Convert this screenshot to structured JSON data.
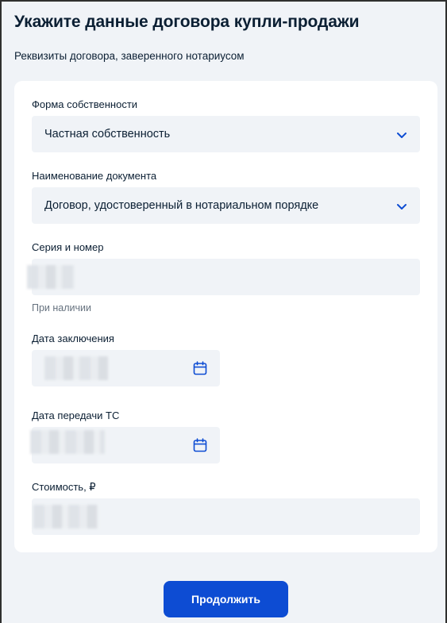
{
  "page": {
    "title": "Укажите данные договора купли-продажи",
    "subtitle": "Реквизиты договора, заверенного нотариусом"
  },
  "form": {
    "ownership": {
      "label": "Форма собственности",
      "value": "Частная собственность",
      "icon": "chevron-down-icon"
    },
    "document_name": {
      "label": "Наименование документа",
      "value": "Договор, удостоверенный в нотариальном порядке",
      "icon": "chevron-down-icon"
    },
    "series_number": {
      "label": "Серия и номер",
      "hint": "При наличии"
    },
    "contract_date": {
      "label": "Дата заключения",
      "icon": "calendar-icon"
    },
    "transfer_date": {
      "label": "Дата передачи ТС",
      "icon": "calendar-icon"
    },
    "price": {
      "label": "Стоимость, ₽"
    }
  },
  "actions": {
    "continue_label": "Продолжить"
  },
  "colors": {
    "accent": "#0d4cd3",
    "field_bg": "#f0f3f7",
    "text": "#0b1f33",
    "hint": "#66727f"
  }
}
